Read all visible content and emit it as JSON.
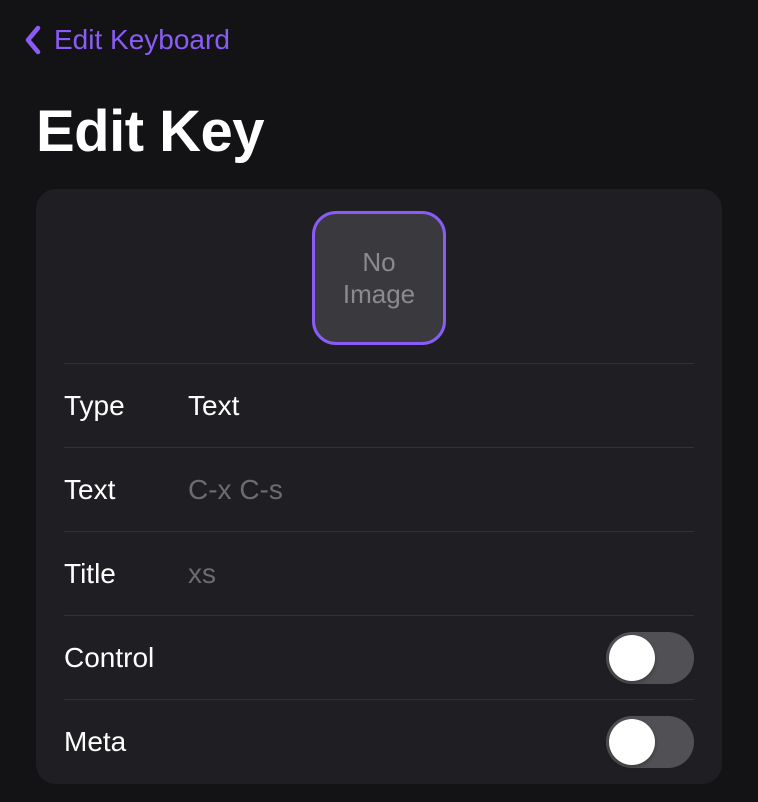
{
  "nav": {
    "back_label": "Edit Keyboard"
  },
  "header": {
    "title": "Edit Key"
  },
  "image_box": {
    "placeholder_text": "No\nImage"
  },
  "rows": {
    "type": {
      "label": "Type",
      "value": "Text"
    },
    "text": {
      "label": "Text",
      "placeholder": "C-x C-s"
    },
    "title": {
      "label": "Title",
      "placeholder": "xs"
    },
    "control": {
      "label": "Control",
      "enabled": false
    },
    "meta": {
      "label": "Meta",
      "enabled": false
    }
  },
  "colors": {
    "accent": "#8a5cf6"
  }
}
